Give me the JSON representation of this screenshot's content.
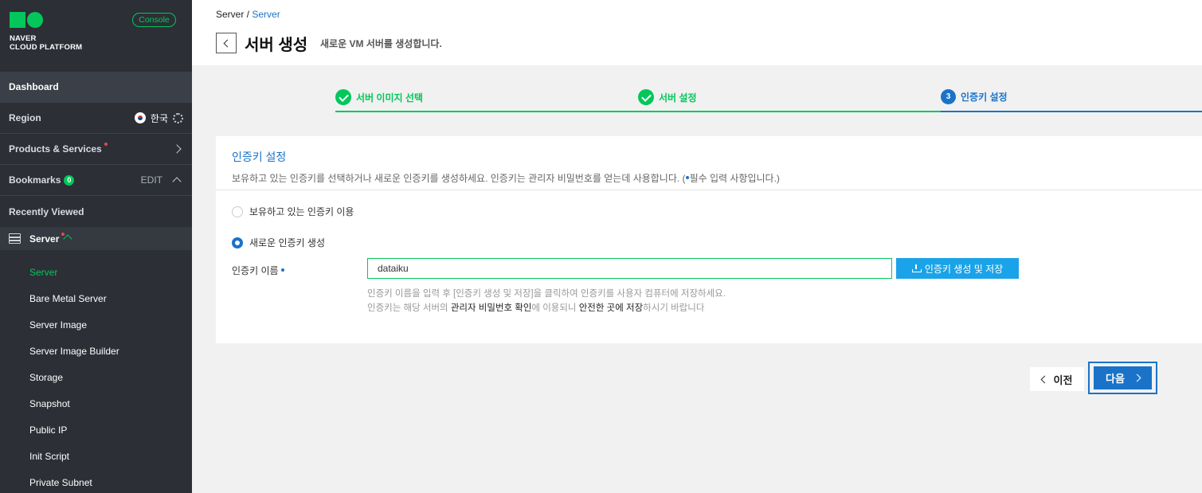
{
  "brand": {
    "line1": "NAVER",
    "line2": "CLOUD PLATFORM",
    "console_label": "Console",
    "accent": "#03c75a"
  },
  "sidebar": {
    "dashboard": "Dashboard",
    "region_label": "Region",
    "region_value": "한국",
    "products": "Products & Services",
    "bookmarks": "Bookmarks",
    "bookmarks_count": "0",
    "bookmarks_edit": "EDIT",
    "recent": "Recently Viewed",
    "server_group": "Server",
    "items": [
      "Server",
      "Bare Metal Server",
      "Server Image",
      "Server Image Builder",
      "Storage",
      "Snapshot",
      "Public IP",
      "Init Script",
      "Private Subnet"
    ]
  },
  "header": {
    "breadcrumb_root": "Server /",
    "breadcrumb_current": "Server",
    "title": "서버 생성",
    "subtitle": "새로운 VM 서버를 생성합니다."
  },
  "steps": [
    {
      "label": "서버 이미지 선택",
      "state": "done"
    },
    {
      "label": "서버 설정",
      "state": "done"
    },
    {
      "label": "인증키 설정",
      "state": "current",
      "number": "3"
    }
  ],
  "card": {
    "title": "인증키 설정",
    "desc": "보유하고 있는 인증키를 선택하거나 새로운 인증키를 생성하세요. 인증키는 관리자 비밀번호를 얻는데 사용합니다. (",
    "desc_tail": "필수 입력 사항입니다.)",
    "option_existing": "보유하고 있는 인증키 이용",
    "option_new": "새로운 인증키 생성",
    "field_label": "인증키 이름",
    "field_value": "dataiku",
    "save_button": "인증키 생성 및 저장",
    "help1": "인증키 이름을 입력 후 [인증키 생성 및 저장]을 클릭하여 인증키를 사용자 컴퓨터에 저장하세요.",
    "help2_a": "인증키는 해당 서버의 ",
    "help2_b": "관리자 비밀번호 확인",
    "help2_c": "에 이용되니 ",
    "help2_d": "안전한 곳에 저장",
    "help2_e": "하시기 바랍니다"
  },
  "footer": {
    "prev": "이전",
    "next": "다음"
  }
}
